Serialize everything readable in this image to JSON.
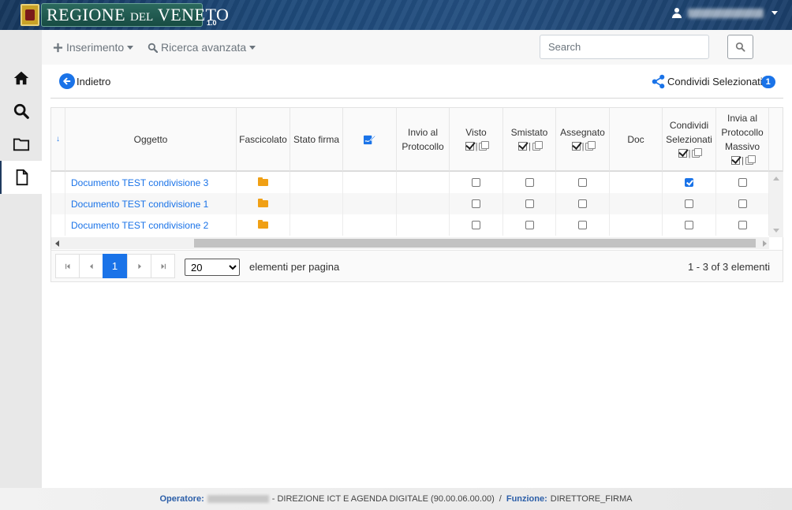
{
  "header": {
    "brand_main": "REGIONE",
    "brand_del": "DEL",
    "brand_end": "VENETO",
    "version": "1.0"
  },
  "sidebar": {
    "items": [
      {
        "icon": "home-icon"
      },
      {
        "icon": "search-icon"
      },
      {
        "icon": "folder-icon"
      },
      {
        "icon": "document-icon",
        "active": true
      }
    ]
  },
  "toolbar": {
    "insert_label": "Inserimento",
    "advanced_search_label": "Ricerca avanzata",
    "search_placeholder": "Search"
  },
  "actions": {
    "back_label": "Indietro",
    "share_label": "Condividi Selezionati",
    "share_count": "1"
  },
  "grid": {
    "columns": {
      "oggetto": "Oggetto",
      "fascicolato": "Fascicolato",
      "stato_firma": "Stato firma",
      "invio_line1": "Invio al",
      "invio_line2": "Protocollo",
      "visto": "Visto",
      "smistato": "Smistato",
      "assegnato": "Assegnato",
      "doc": "Doc",
      "condividi_line1": "Condividi",
      "condividi_line2": "Selezionati",
      "invia_line1": "Invia al",
      "invia_line2": "Protocollo",
      "invia_line3": "Massivo"
    },
    "header_sep": "|",
    "rows": [
      {
        "oggetto": "Documento TEST condivisione 3",
        "visto": false,
        "smistato": false,
        "assegnato": false,
        "condividi": true,
        "invia": false
      },
      {
        "oggetto": "Documento TEST condivisione 1",
        "visto": false,
        "smistato": false,
        "assegnato": false,
        "condividi": false,
        "invia": false
      },
      {
        "oggetto": "Documento TEST condivisione 2",
        "visto": false,
        "smistato": false,
        "assegnato": false,
        "condividi": false,
        "invia": false
      }
    ]
  },
  "pager": {
    "current_page": "1",
    "page_size": "20",
    "page_size_options": [
      "20"
    ],
    "per_page_label": "elementi per pagina",
    "info": "1 - 3 of 3 elementi"
  },
  "footer": {
    "operatore_label": "Operatore:",
    "department": "- DIREZIONE ICT E AGENDA DIGITALE (90.00.06.00.00)",
    "separator": "/",
    "funzione_label": "Funzione:",
    "funzione_value": "DIRETTORE_FIRMA"
  },
  "colors": {
    "accent": "#1a73e8",
    "header_bg": "#1e4a7a",
    "folder": "#f0a015"
  }
}
